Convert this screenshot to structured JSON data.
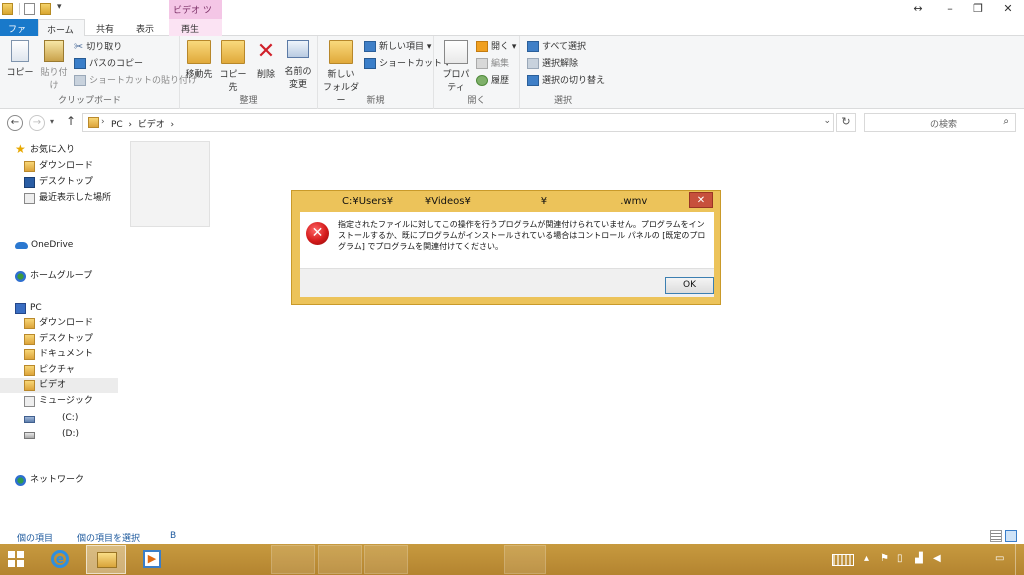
{
  "ribbon_tabs": {
    "file": "ファイル",
    "home": "ホーム",
    "share": "共有",
    "view": "表示",
    "context_header": "ビデオ ツール",
    "play": "再生"
  },
  "ribbon": {
    "clipboard": {
      "copy": "コピー",
      "paste": "貼り付け",
      "cut": "切り取り",
      "copy_path": "パスのコピー",
      "paste_shortcut": "ショートカットの貼り付け",
      "label": "クリップボード"
    },
    "organize": {
      "move_to": "移動先",
      "copy_to": "コピー先",
      "delete": "削除",
      "rename_line1": "名前の",
      "rename_line2": "変更",
      "label": "整理"
    },
    "new": {
      "new_folder_line1": "新しい",
      "new_folder_line2": "フォルダー",
      "new_item": "新しい項目",
      "shortcut": "ショートカット",
      "label": "新規"
    },
    "open": {
      "properties": "プロパティ",
      "open": "開く",
      "edit": "編集",
      "history": "履歴",
      "label": "開く"
    },
    "select": {
      "select_all": "すべて選択",
      "select_none": "選択解除",
      "invert": "選択の切り替え",
      "label": "選択"
    }
  },
  "address": {
    "path": "PC  ›  ビデオ  ›",
    "search_placeholder": "の検索"
  },
  "nav": {
    "favorites": "お気に入り",
    "downloads": "ダウンロード",
    "desktop": "デスクトップ",
    "recent": "最近表示した場所",
    "onedrive": "OneDrive",
    "homegroup": "ホームグループ",
    "pc": "PC",
    "pc_downloads": "ダウンロード",
    "pc_desktop": "デスクトップ",
    "documents": "ドキュメント",
    "pictures": "ピクチャ",
    "videos": "ビデオ",
    "music": "ミュージック",
    "drive_c": "(C:)",
    "drive_d": "(D:)",
    "network": "ネットワーク"
  },
  "dialog": {
    "title": "C:¥Users¥          ¥Videos¥                      ¥                       .wmv",
    "message": "指定されたファイルに対してこの操作を行うプログラムが関連付けられていません。プログラムをインストールするか、既にプログラムがインストールされている場合はコントロール パネルの [既定のプログラム] でプログラムを関連付けてください。",
    "ok": "OK",
    "close": "✕"
  },
  "status": {
    "items": "個の項目",
    "selected": "個の項目を選択",
    "size": "B"
  },
  "colors": {
    "file_tab": "#1979ca",
    "context_tab": "#f4c6e6",
    "dialog_frame": "#ecc35a",
    "taskbar": "#c79a3f",
    "close_button": "#c7503c"
  }
}
